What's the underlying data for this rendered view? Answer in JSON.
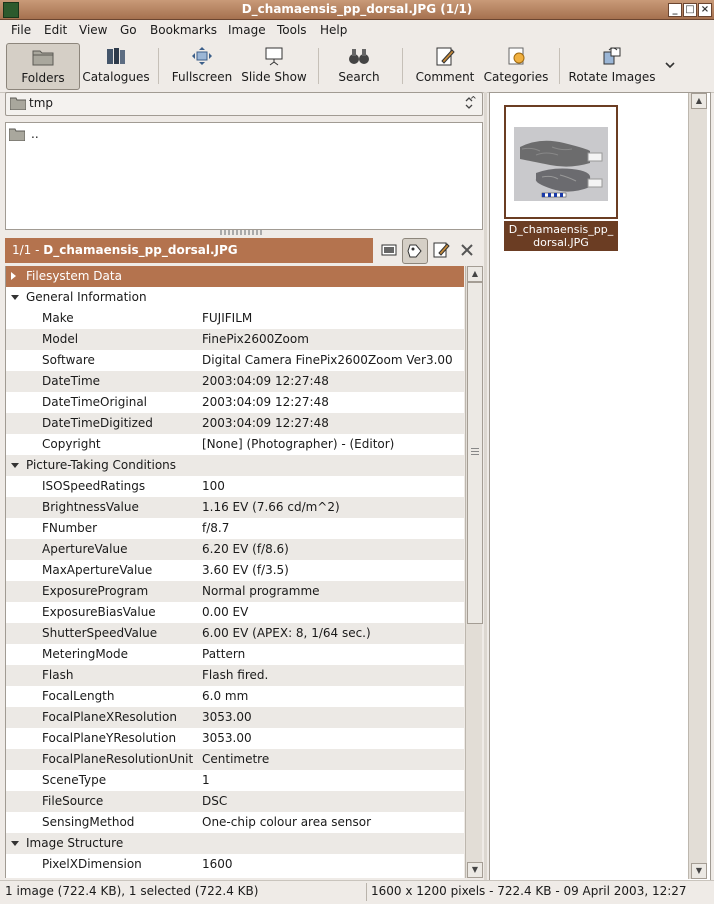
{
  "window": {
    "title": "D_chamaensis_pp_dorsal.JPG  (1/1)",
    "accent_color": "#b4734e",
    "controls": [
      "minimize",
      "maximize",
      "close"
    ]
  },
  "menu": {
    "items": [
      {
        "label": "File"
      },
      {
        "label": "Edit"
      },
      {
        "label": "View"
      },
      {
        "label": "Go"
      },
      {
        "label": "Bookmarks"
      },
      {
        "label": "Image"
      },
      {
        "label": "Tools"
      },
      {
        "label": "Help"
      }
    ]
  },
  "toolbar": {
    "buttons": [
      {
        "label": "Folders",
        "icon": "folder-icon",
        "active": true
      },
      {
        "label": "Catalogues",
        "icon": "books-icon"
      },
      {
        "label": "Fullscreen",
        "icon": "fullscreen-icon"
      },
      {
        "label": "Slide Show",
        "icon": "slideshow-icon"
      },
      {
        "label": "Search",
        "icon": "binoculars-icon"
      },
      {
        "label": "Comment",
        "icon": "comment-icon"
      },
      {
        "label": "Categories",
        "icon": "categories-icon"
      },
      {
        "label": "Rotate Images",
        "icon": "rotate-icon"
      }
    ],
    "overflow_icon": "chevron-down-icon"
  },
  "folder_selector": {
    "value": "tmp"
  },
  "folder_list": {
    "items": [
      ".."
    ]
  },
  "image_info": {
    "position": "1/1",
    "separator": " - ",
    "filename": "D_chamaensis_pp_dorsal.JPG"
  },
  "properties": {
    "sections": [
      {
        "name": "Filesystem Data",
        "expanded": false,
        "selected": true,
        "rows": []
      },
      {
        "name": "General Information",
        "expanded": true,
        "rows": [
          {
            "key": "Make",
            "value": "FUJIFILM"
          },
          {
            "key": "Model",
            "value": "FinePix2600Zoom"
          },
          {
            "key": "Software",
            "value": "Digital Camera FinePix2600Zoom Ver3.00"
          },
          {
            "key": "DateTime",
            "value": "2003:04:09 12:27:48"
          },
          {
            "key": "DateTimeOriginal",
            "value": "2003:04:09 12:27:48"
          },
          {
            "key": "DateTimeDigitized",
            "value": "2003:04:09 12:27:48"
          },
          {
            "key": "Copyright",
            "value": "[None] (Photographer) -  (Editor)"
          }
        ]
      },
      {
        "name": "Picture-Taking Conditions",
        "expanded": true,
        "rows": [
          {
            "key": "ISOSpeedRatings",
            "value": "100"
          },
          {
            "key": "BrightnessValue",
            "value": "1.16 EV (7.66 cd/m^2)"
          },
          {
            "key": "FNumber",
            "value": "f/8.7"
          },
          {
            "key": "ApertureValue",
            "value": "6.20 EV (f/8.6)"
          },
          {
            "key": "MaxApertureValue",
            "value": "3.60 EV (f/3.5)"
          },
          {
            "key": "ExposureProgram",
            "value": "Normal programme"
          },
          {
            "key": "ExposureBiasValue",
            "value": "0.00 EV"
          },
          {
            "key": "ShutterSpeedValue",
            "value": "6.00 EV (APEX: 8, 1/64 sec.)"
          },
          {
            "key": "MeteringMode",
            "value": "Pattern"
          },
          {
            "key": "Flash",
            "value": "Flash fired."
          },
          {
            "key": "FocalLength",
            "value": "6.0 mm"
          },
          {
            "key": "FocalPlaneXResolution",
            "value": "3053.00"
          },
          {
            "key": "FocalPlaneYResolution",
            "value": "3053.00"
          },
          {
            "key": "FocalPlaneResolutionUnit",
            "value": "Centimetre"
          },
          {
            "key": "SceneType",
            "value": "1"
          },
          {
            "key": "FileSource",
            "value": "DSC"
          },
          {
            "key": "SensingMethod",
            "value": "One-chip colour area sensor"
          }
        ]
      },
      {
        "name": "Image Structure",
        "expanded": true,
        "rows": [
          {
            "key": "PixelXDimension",
            "value": "1600"
          }
        ]
      }
    ]
  },
  "thumbnails": [
    {
      "caption": "D_chamaensis_pp_dorsal.JPG",
      "selected": true
    }
  ],
  "status": {
    "left": "1 image (722.4 KB), 1 selected (722.4 KB)",
    "right": "1600 x 1200 pixels - 722.4 KB - 09 April 2003, 12:27"
  }
}
